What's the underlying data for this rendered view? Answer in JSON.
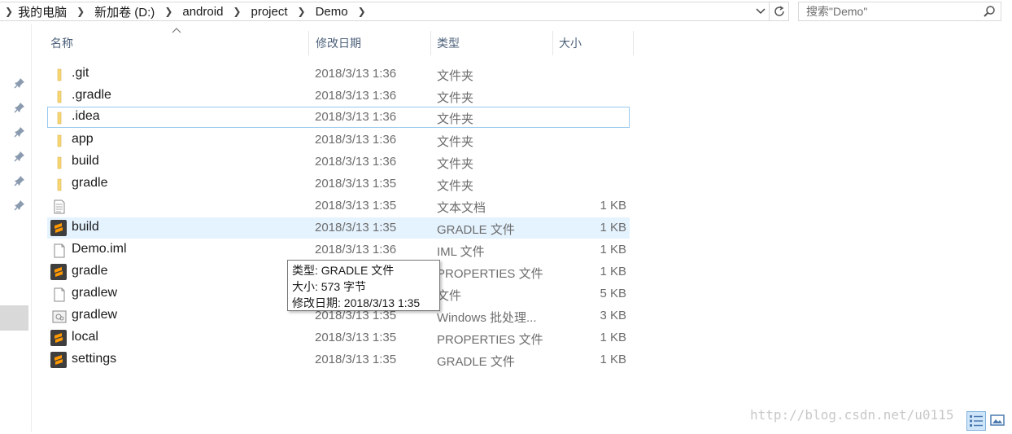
{
  "address_bar": {
    "crumbs": [
      "我的电脑",
      "新加卷 (D:)",
      "android",
      "project",
      "Demo"
    ]
  },
  "search": {
    "placeholder": "搜索\"Demo\""
  },
  "columns": {
    "name": "名称",
    "date": "修改日期",
    "type": "类型",
    "size": "大小"
  },
  "files": [
    {
      "icon": "folder-icon",
      "name": ".git",
      "date": "2018/3/13 1:36",
      "type": "文件夹",
      "size": ""
    },
    {
      "icon": "folder-icon",
      "name": ".gradle",
      "date": "2018/3/13 1:36",
      "type": "文件夹",
      "size": ""
    },
    {
      "icon": "folder-icon",
      "name": ".idea",
      "date": "2018/3/13 1:36",
      "type": "文件夹",
      "size": ""
    },
    {
      "icon": "folder-icon",
      "name": "app",
      "date": "2018/3/13 1:36",
      "type": "文件夹",
      "size": ""
    },
    {
      "icon": "folder-icon",
      "name": "build",
      "date": "2018/3/13 1:36",
      "type": "文件夹",
      "size": ""
    },
    {
      "icon": "folder-icon",
      "name": "gradle",
      "date": "2018/3/13 1:35",
      "type": "文件夹",
      "size": ""
    },
    {
      "icon": "text-document-icon",
      "name": "",
      "date": "2018/3/13 1:35",
      "type": "文本文档",
      "size": "1 KB"
    },
    {
      "icon": "sublime-file-icon",
      "name": "build",
      "date": "2018/3/13 1:35",
      "type": "GRADLE 文件",
      "size": "1 KB"
    },
    {
      "icon": "blank-file-icon",
      "name": "Demo.iml",
      "date": "2018/3/13 1:36",
      "type": "IML 文件",
      "size": "1 KB"
    },
    {
      "icon": "sublime-file-icon",
      "name": "gradle",
      "date": "",
      "type": "PROPERTIES 文件",
      "size": "1 KB"
    },
    {
      "icon": "blank-file-icon",
      "name": "gradlew",
      "date": "",
      "type": "文件",
      "size": "5 KB"
    },
    {
      "icon": "batch-file-icon",
      "name": "gradlew",
      "date": "2018/3/13 1:35",
      "type": "Windows 批处理...",
      "size": "3 KB"
    },
    {
      "icon": "sublime-file-icon",
      "name": "local",
      "date": "2018/3/13 1:35",
      "type": "PROPERTIES 文件",
      "size": "1 KB"
    },
    {
      "icon": "sublime-file-icon",
      "name": "settings",
      "date": "2018/3/13 1:35",
      "type": "GRADLE 文件",
      "size": "1 KB"
    }
  ],
  "tooltip": {
    "type": "类型: GRADLE 文件",
    "size": "大小: 573 字节",
    "modified": "修改日期: 2018/3/13 1:35"
  },
  "watermark": "http://blog.csdn.net/u0115",
  "colors": {
    "folder": "#f8d775",
    "sublime": "#ff9800",
    "hover_row": "#e5f3ff",
    "focus_border": "#99c9ef",
    "header_text": "#4c607a"
  }
}
